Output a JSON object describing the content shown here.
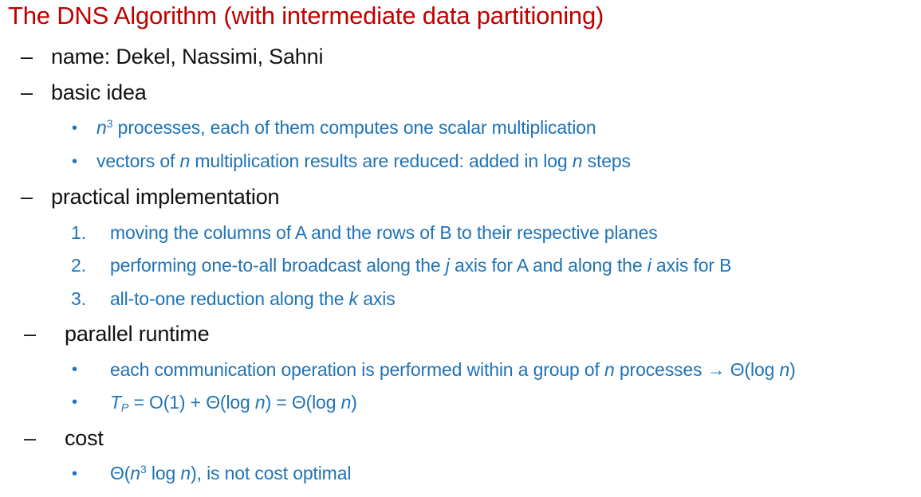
{
  "title": "The DNS Algorithm (with intermediate data partitioning)",
  "markers": {
    "dash": "–",
    "bullet": "•"
  },
  "items": {
    "name": "name: Dekel, Nassimi, Sahni",
    "basic_idea": {
      "heading": "basic idea",
      "b1": {
        "var": "n",
        "exp": "3",
        "text": " processes, each of them computes one scalar multiplication"
      },
      "b2": {
        "t1": "vectors of ",
        "var1": "n",
        "t2": " multiplication results are reduced: added in log ",
        "var2": "n",
        "t3": " steps"
      }
    },
    "practical": {
      "heading": "practical implementation",
      "s1": {
        "num": "1.",
        "text": "moving the columns of A and the rows of B to their respective planes"
      },
      "s2": {
        "num": "2.",
        "t1": "performing one-to-all broadcast along the ",
        "var1": "j",
        "t2": " axis for A and along the ",
        "var2": "i",
        "t3": " axis for B"
      },
      "s3": {
        "num": "3.",
        "t1": "all-to-one reduction along the ",
        "var1": "k",
        "t2": " axis"
      }
    },
    "runtime": {
      "heading": "parallel runtime",
      "b1": {
        "t1": "each communication operation is performed within a group of ",
        "var1": "n",
        "t2": " processes ",
        "arrow": "→",
        "t3": " Θ(log ",
        "var2": "n",
        "t4": ")"
      },
      "b2": {
        "var1": "T",
        "sub": "P",
        "t1": " = O(1) + Θ(log ",
        "var2": "n",
        "t2": ") = Θ(log ",
        "var3": "n",
        "t3": ")"
      }
    },
    "cost": {
      "heading": "cost",
      "b1": {
        "t1": "Θ(",
        "var1": "n",
        "exp": "3",
        "t2": " log ",
        "var2": "n",
        "t3": "), is not cost optimal"
      }
    }
  }
}
